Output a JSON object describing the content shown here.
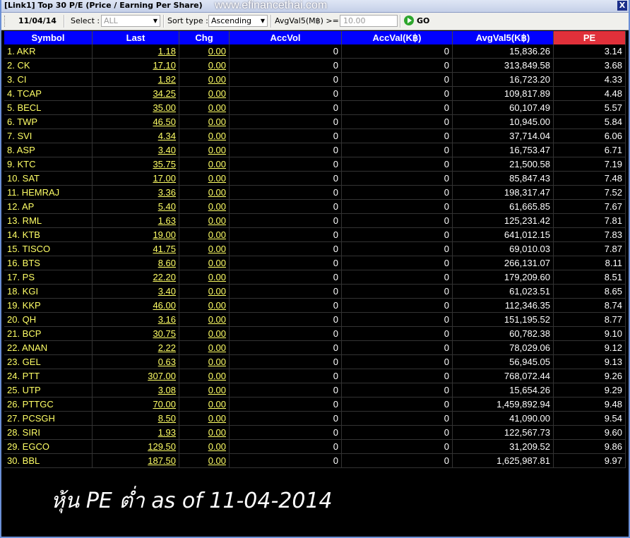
{
  "window": {
    "title": "[Link1] Top 30 P/E (Price / Earning Per Share)",
    "watermark": "www.efinancethai.com",
    "close_label": "X"
  },
  "toolbar": {
    "date": "11/04/14",
    "select_label": "Select :",
    "select_value": "ALL",
    "sort_label": "Sort type :",
    "sort_value": "Ascending",
    "filter_label": "AvgVal5(M฿) >=",
    "filter_placeholder": "10.00",
    "go_label": "GO"
  },
  "table": {
    "columns": [
      "Symbol",
      "Last",
      "Chg",
      "AccVol",
      "AccVal(K฿)",
      "AvgVal5(K฿)",
      "PE"
    ],
    "rows": [
      [
        "1. AKR",
        "1.18",
        "0.00",
        "0",
        "0",
        "15,836.26",
        "3.14"
      ],
      [
        "2. CK",
        "17.10",
        "0.00",
        "0",
        "0",
        "313,849.58",
        "3.68"
      ],
      [
        "3. CI",
        "1.82",
        "0.00",
        "0",
        "0",
        "16,723.20",
        "4.33"
      ],
      [
        "4. TCAP",
        "34.25",
        "0.00",
        "0",
        "0",
        "109,817.89",
        "4.48"
      ],
      [
        "5. BECL",
        "35.00",
        "0.00",
        "0",
        "0",
        "60,107.49",
        "5.57"
      ],
      [
        "6. TWP",
        "46.50",
        "0.00",
        "0",
        "0",
        "10,945.00",
        "5.84"
      ],
      [
        "7. SVI",
        "4.34",
        "0.00",
        "0",
        "0",
        "37,714.04",
        "6.06"
      ],
      [
        "8. ASP",
        "3.40",
        "0.00",
        "0",
        "0",
        "16,753.47",
        "6.71"
      ],
      [
        "9. KTC",
        "35.75",
        "0.00",
        "0",
        "0",
        "21,500.58",
        "7.19"
      ],
      [
        "10. SAT",
        "17.00",
        "0.00",
        "0",
        "0",
        "85,847.43",
        "7.48"
      ],
      [
        "11. HEMRAJ",
        "3.36",
        "0.00",
        "0",
        "0",
        "198,317.47",
        "7.52"
      ],
      [
        "12. AP",
        "5.40",
        "0.00",
        "0",
        "0",
        "61,665.85",
        "7.67"
      ],
      [
        "13. RML",
        "1.63",
        "0.00",
        "0",
        "0",
        "125,231.42",
        "7.81"
      ],
      [
        "14. KTB",
        "19.00",
        "0.00",
        "0",
        "0",
        "641,012.15",
        "7.83"
      ],
      [
        "15. TISCO",
        "41.75",
        "0.00",
        "0",
        "0",
        "69,010.03",
        "7.87"
      ],
      [
        "16. BTS",
        "8.60",
        "0.00",
        "0",
        "0",
        "266,131.07",
        "8.11"
      ],
      [
        "17. PS",
        "22.20",
        "0.00",
        "0",
        "0",
        "179,209.60",
        "8.51"
      ],
      [
        "18. KGI",
        "3.40",
        "0.00",
        "0",
        "0",
        "61,023.51",
        "8.65"
      ],
      [
        "19. KKP",
        "46.00",
        "0.00",
        "0",
        "0",
        "112,346.35",
        "8.74"
      ],
      [
        "20. QH",
        "3.16",
        "0.00",
        "0",
        "0",
        "151,195.52",
        "8.77"
      ],
      [
        "21. BCP",
        "30.75",
        "0.00",
        "0",
        "0",
        "60,782.38",
        "9.10"
      ],
      [
        "22. ANAN",
        "2.22",
        "0.00",
        "0",
        "0",
        "78,029.06",
        "9.12"
      ],
      [
        "23. GEL",
        "0.63",
        "0.00",
        "0",
        "0",
        "56,945.05",
        "9.13"
      ],
      [
        "24. PTT",
        "307.00",
        "0.00",
        "0",
        "0",
        "768,072.44",
        "9.26"
      ],
      [
        "25. UTP",
        "3.08",
        "0.00",
        "0",
        "0",
        "15,654.26",
        "9.29"
      ],
      [
        "26. PTTGC",
        "70.00",
        "0.00",
        "0",
        "0",
        "1,459,892.94",
        "9.48"
      ],
      [
        "27. PCSGH",
        "8.50",
        "0.00",
        "0",
        "0",
        "41,090.00",
        "9.54"
      ],
      [
        "28. SIRI",
        "1.93",
        "0.00",
        "0",
        "0",
        "122,567.73",
        "9.60"
      ],
      [
        "29. EGCO",
        "129.50",
        "0.00",
        "0",
        "0",
        "31,209.52",
        "9.86"
      ],
      [
        "30. BBL",
        "187.50",
        "0.00",
        "0",
        "0",
        "1,625,987.81",
        "9.97"
      ]
    ]
  },
  "caption": "หุ้น PE ต่ำ as of 11-04-2014"
}
